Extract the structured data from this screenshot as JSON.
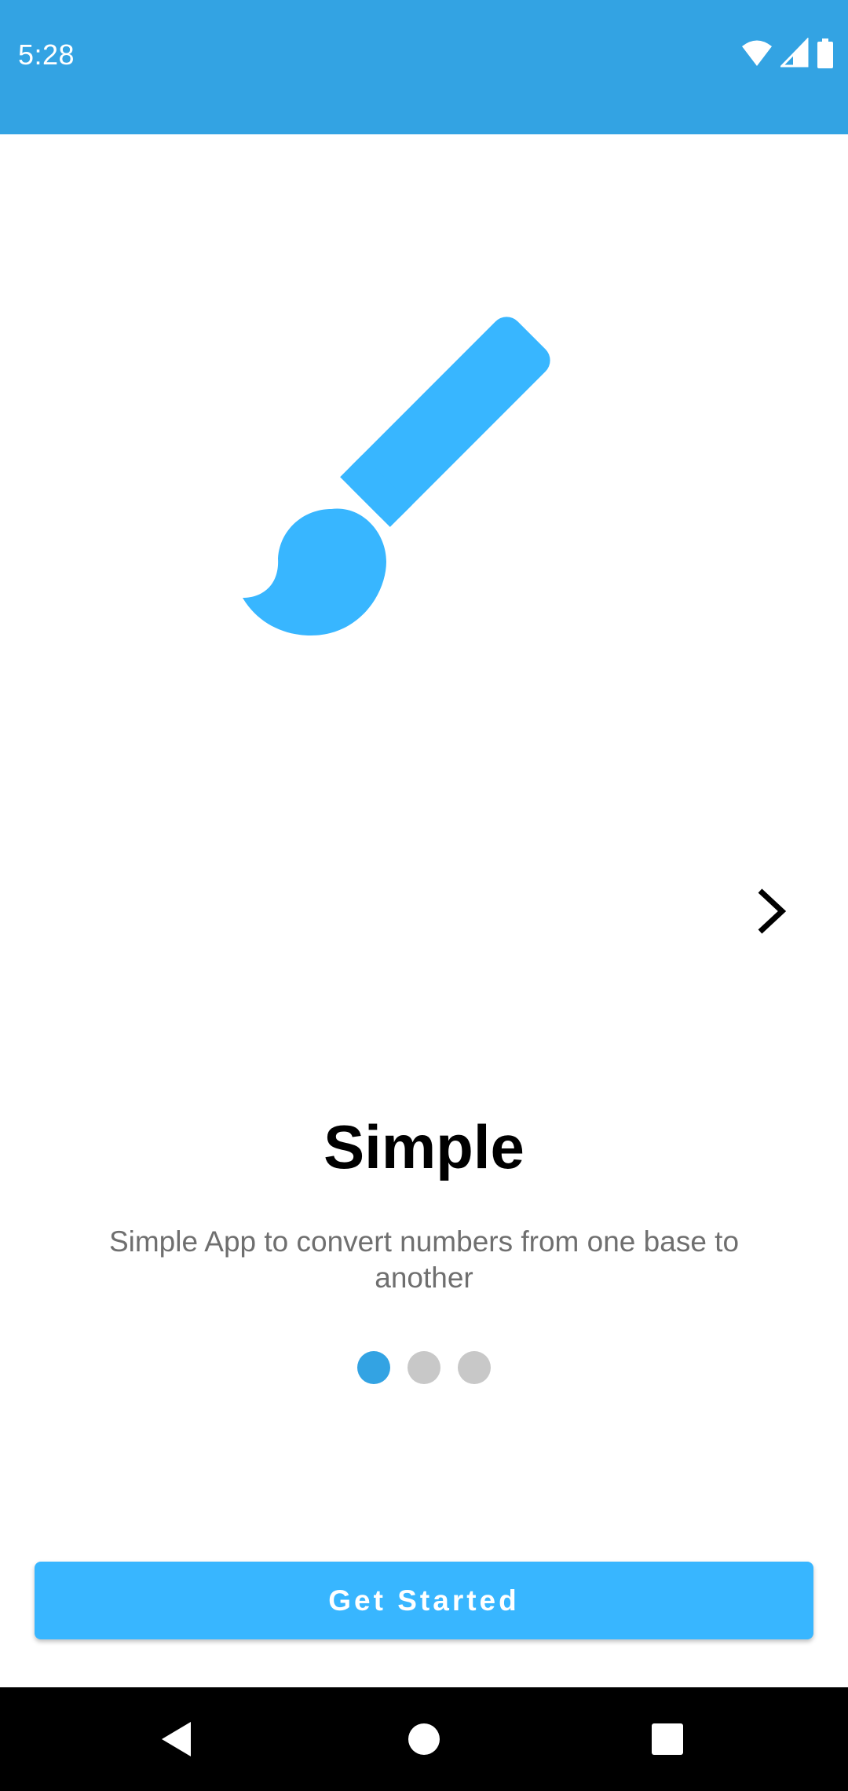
{
  "status_bar": {
    "time": "5:28",
    "icons": [
      "wifi-icon",
      "cell-signal-icon",
      "battery-icon"
    ],
    "color": "#33a3e3"
  },
  "onboarding": {
    "illustration_icon": "paint-brush-icon",
    "accent_color": "#38b6ff",
    "next_icon": "chevron-right-icon",
    "title": "Simple",
    "description": "Simple App to convert numbers from one base to another",
    "page_indicator": {
      "total": 3,
      "current": 1
    }
  },
  "actions": {
    "get_started_label": "Get Started"
  },
  "nav_bar": {
    "buttons": [
      "back-icon",
      "home-icon",
      "recents-icon"
    ]
  }
}
